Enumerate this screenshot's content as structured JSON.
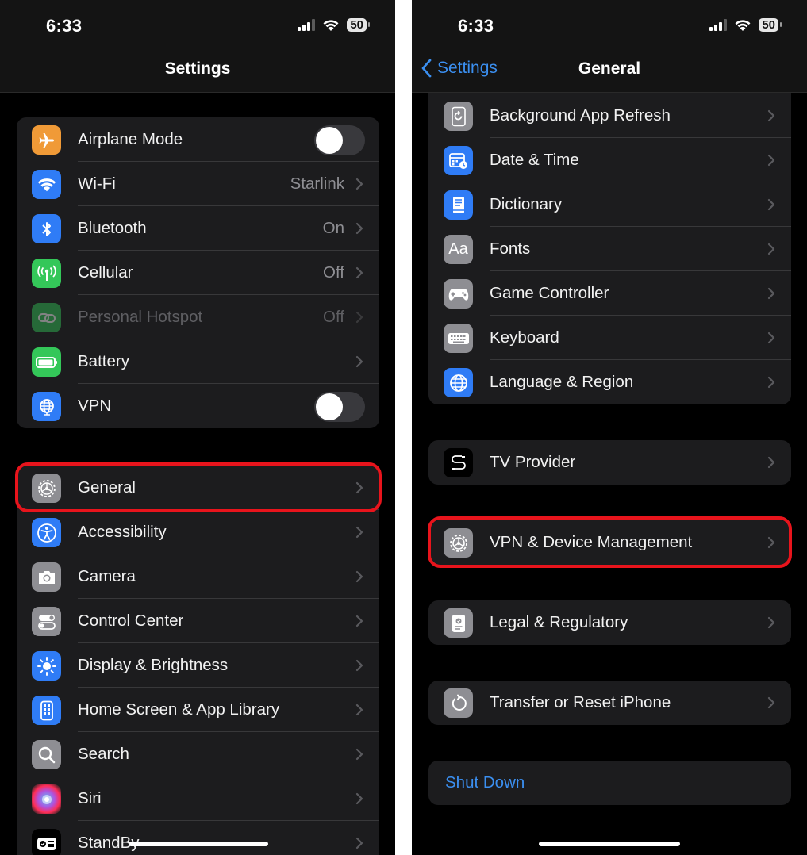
{
  "left": {
    "status": {
      "time": "6:33",
      "battery": "50"
    },
    "nav": {
      "title": "Settings"
    },
    "group1": [
      {
        "label": "Airplane Mode",
        "icon": "airplane-icon",
        "color": "#f09a37",
        "control": "toggle"
      },
      {
        "label": "Wi-Fi",
        "value": "Starlink",
        "icon": "wifi-icon",
        "color": "#2f7cf6"
      },
      {
        "label": "Bluetooth",
        "value": "On",
        "icon": "bluetooth-icon",
        "color": "#2f7cf6"
      },
      {
        "label": "Cellular",
        "value": "Off",
        "icon": "antenna-icon",
        "color": "#34c759"
      },
      {
        "label": "Personal Hotspot",
        "value": "Off",
        "icon": "hotspot-icon",
        "color": "#34c759",
        "disabled": true
      },
      {
        "label": "Battery",
        "icon": "battery-icon",
        "color": "#34c759"
      },
      {
        "label": "VPN",
        "icon": "globe-icon",
        "color": "#2f7cf6",
        "control": "toggle"
      }
    ],
    "group2": [
      {
        "label": "General",
        "icon": "gear-icon",
        "color": "#8e8e93"
      },
      {
        "label": "Accessibility",
        "icon": "accessibility-icon",
        "color": "#2f7cf6"
      },
      {
        "label": "Camera",
        "icon": "camera-icon",
        "color": "#8e8e93"
      },
      {
        "label": "Control Center",
        "icon": "switches-icon",
        "color": "#8e8e93"
      },
      {
        "label": "Display & Brightness",
        "icon": "sun-icon",
        "color": "#2f7cf6"
      },
      {
        "label": "Home Screen & App Library",
        "icon": "phone-grid-icon",
        "color": "#2f7cf6"
      },
      {
        "label": "Search",
        "icon": "magnifier-icon",
        "color": "#8e8e93"
      },
      {
        "label": "Siri",
        "icon": "siri-icon",
        "color": "#222"
      },
      {
        "label": "StandBy",
        "icon": "standby-icon",
        "color": "#1c1c1e"
      }
    ]
  },
  "right": {
    "status": {
      "time": "6:33",
      "battery": "50"
    },
    "nav": {
      "back_label": "Settings",
      "title": "General"
    },
    "group1": [
      {
        "label": "Background App Refresh",
        "icon": "refresh-icon",
        "color": "#8e8e93"
      },
      {
        "label": "Date & Time",
        "icon": "calendar-clock-icon",
        "color": "#2f7cf6"
      },
      {
        "label": "Dictionary",
        "icon": "book-icon",
        "color": "#2f7cf6"
      },
      {
        "label": "Fonts",
        "icon": "fonts-icon",
        "color": "#8e8e93",
        "glyph": "Aa"
      },
      {
        "label": "Game Controller",
        "icon": "gamepad-icon",
        "color": "#8e8e93"
      },
      {
        "label": "Keyboard",
        "icon": "keyboard-icon",
        "color": "#8e8e93"
      },
      {
        "label": "Language & Region",
        "icon": "globe-icon",
        "color": "#2f7cf6"
      }
    ],
    "tv_provider": {
      "label": "TV Provider",
      "icon": "tv-provider-icon",
      "color": "#111"
    },
    "vpn_device": {
      "label": "VPN & Device Management",
      "icon": "gear-icon",
      "color": "#8e8e93"
    },
    "legal": {
      "label": "Legal & Regulatory",
      "icon": "certificate-icon",
      "color": "#8e8e93"
    },
    "transfer": {
      "label": "Transfer or Reset iPhone",
      "icon": "reset-icon",
      "color": "#8e8e93"
    },
    "shutdown": {
      "label": "Shut Down"
    }
  },
  "colors": {
    "highlight": "#e8141c",
    "accent": "#3b8ff0"
  }
}
